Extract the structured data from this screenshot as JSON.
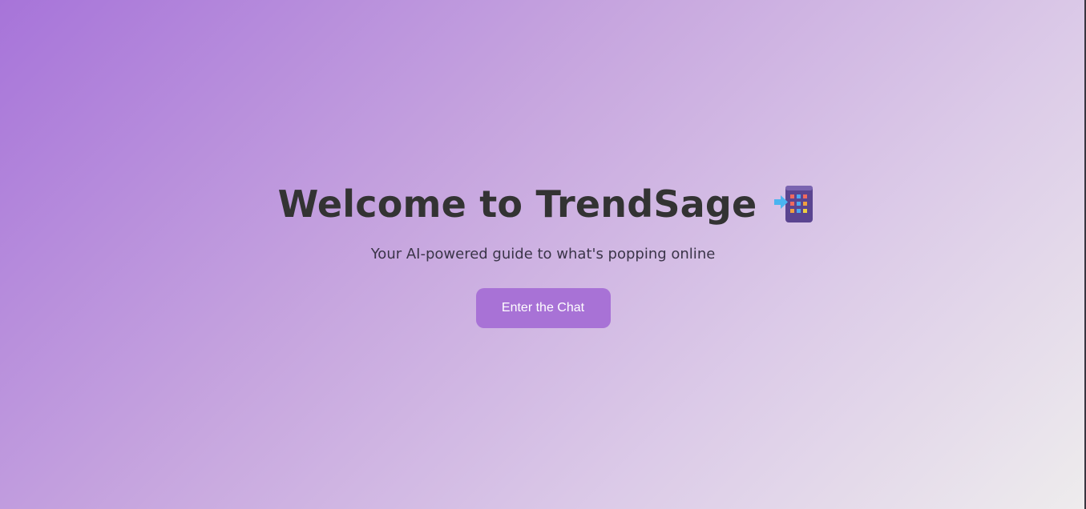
{
  "hero": {
    "title": "Welcome to TrendSage",
    "title_icon": "calculator-with-arrow-icon",
    "subtitle": "Your AI-powered guide to what's popping online",
    "cta_label": "Enter the Chat"
  },
  "colors": {
    "gradient_start": "#a774d9",
    "gradient_end": "#eeeced",
    "button_bg": "#a872d6",
    "title_text": "#333333"
  }
}
